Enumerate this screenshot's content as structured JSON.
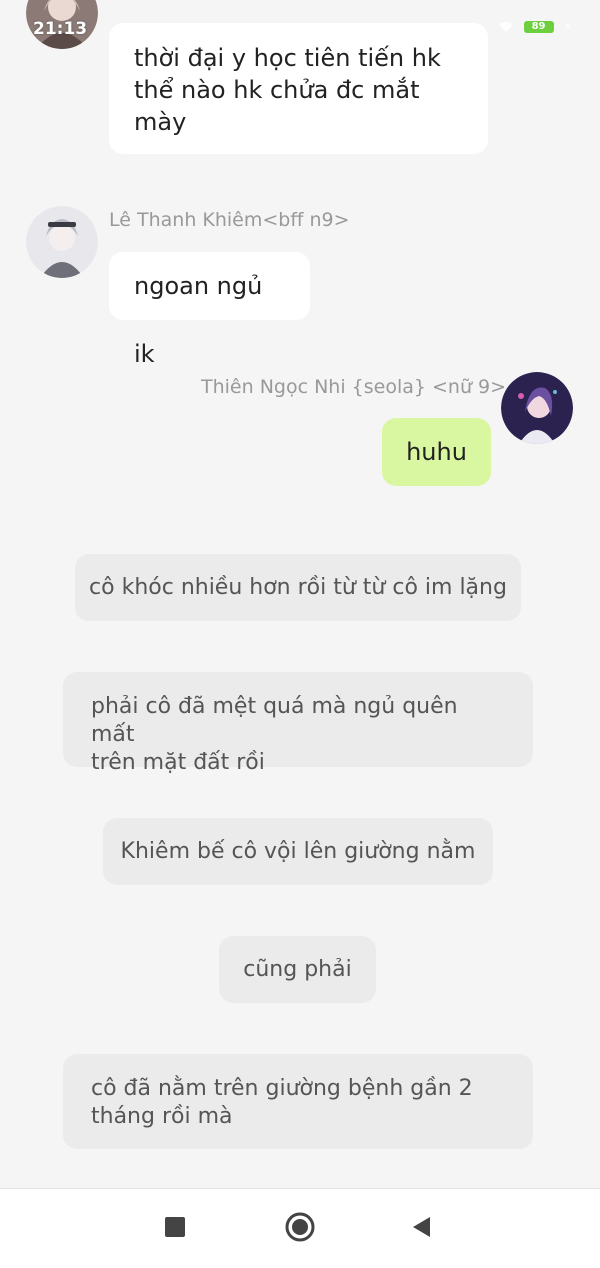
{
  "status_bar": {
    "time": "21:13",
    "battery": "89"
  },
  "messages": [
    {
      "sender": "",
      "text": "thời đại y học tiên tiến hk\nthể nào hk chửa đc mắt\nmày"
    },
    {
      "sender": "Lê Thanh Khiêm<bff n9>",
      "text": "ngoan ngủ ik"
    },
    {
      "sender": "Thiên Ngọc Nhi {seola} <nữ 9>",
      "text": "huhu"
    }
  ],
  "narrations": [
    "cô khóc nhiều hơn rồi từ từ cô im lặng",
    "phải cô đã mệt quá mà ngủ quên mất\ntrên mặt đất rồi",
    "Khiêm bế cô vội lên giường nằm",
    "cũng phải",
    "cô đã nằm trên giường bệnh gần 2\ntháng rồi mà"
  ],
  "colors": {
    "background": "#f5f5f5",
    "my_bubble": "#d9f7a0",
    "their_bubble": "#ffffff",
    "narration_bg": "#ebebeb",
    "battery": "#6ccf3e"
  },
  "icons": {
    "nav_recent": "square-icon",
    "nav_home": "circle-home-icon",
    "nav_back": "triangle-back-icon"
  }
}
